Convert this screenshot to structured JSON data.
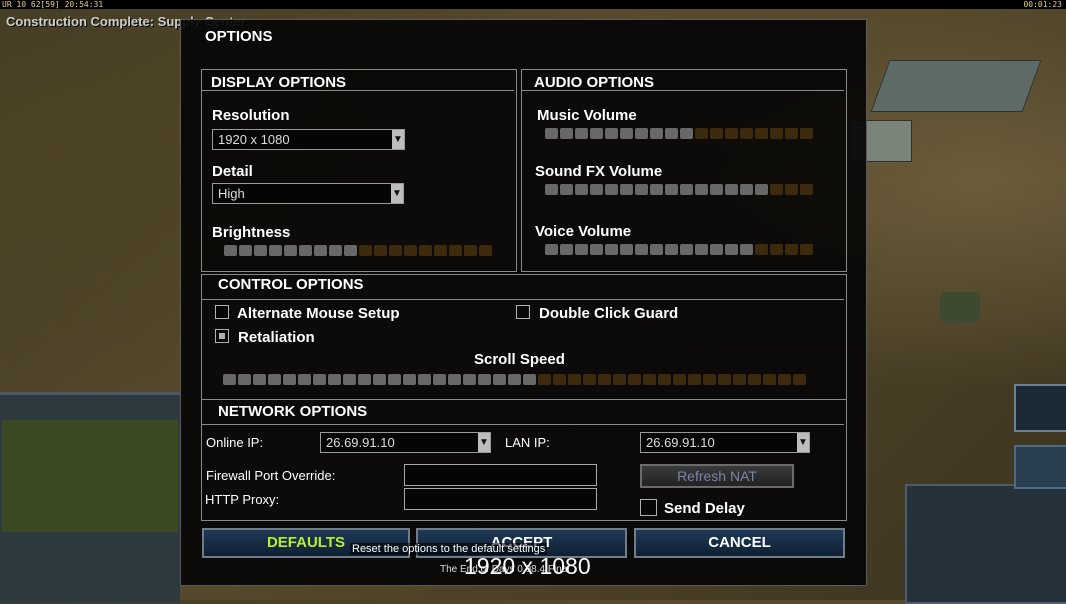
{
  "hud": {
    "left_info": "UR 10 62[59] 20:54:31",
    "right_time": "00:01:23",
    "notice": "Construction Complete: Supply Center"
  },
  "options": {
    "title": "OPTIONS",
    "display": {
      "heading": "DISPLAY OPTIONS",
      "resolution_label": "Resolution",
      "resolution_value": "1920 x 1080",
      "detail_label": "Detail",
      "detail_value": "High",
      "brightness_label": "Brightness",
      "brightness_level": 0.5
    },
    "audio": {
      "heading": "AUDIO OPTIONS",
      "music_label": "Music Volume",
      "music_level": 0.55,
      "sfx_label": "Sound FX Volume",
      "sfx_level": 0.85,
      "voice_label": "Voice Volume",
      "voice_level": 0.75
    },
    "control": {
      "heading": "CONTROL OPTIONS",
      "alt_mouse_label": "Alternate Mouse Setup",
      "alt_mouse_checked": false,
      "double_click_label": "Double Click Guard",
      "double_click_checked": false,
      "retaliation_label": "Retaliation",
      "retaliation_checked": true,
      "scroll_label": "Scroll Speed",
      "scroll_level": 0.55
    },
    "network": {
      "heading": "NETWORK OPTIONS",
      "online_ip_label": "Online IP:",
      "online_ip_value": "26.69.91.10",
      "lan_ip_label": "LAN IP:",
      "lan_ip_value": "26.69.91.10",
      "firewall_label": "Firewall Port Override:",
      "firewall_value": "",
      "proxy_label": "HTTP Proxy:",
      "proxy_value": "",
      "refresh_nat_label": "Refresh NAT",
      "send_delay_label": "Send Delay",
      "send_delay_checked": false
    },
    "buttons": {
      "defaults": "DEFAULTS",
      "accept": "ACCEPT",
      "cancel": "CANCEL"
    },
    "tooltip": "Reset the options to the default settings",
    "footer": "The End of Days 0.98.4 Final",
    "resolution_overlay": "1920 x 1080"
  },
  "colors": {
    "slider_on": "#686868",
    "slider_off": "#3d2a0d",
    "defaults_text": "#b6f02c"
  }
}
